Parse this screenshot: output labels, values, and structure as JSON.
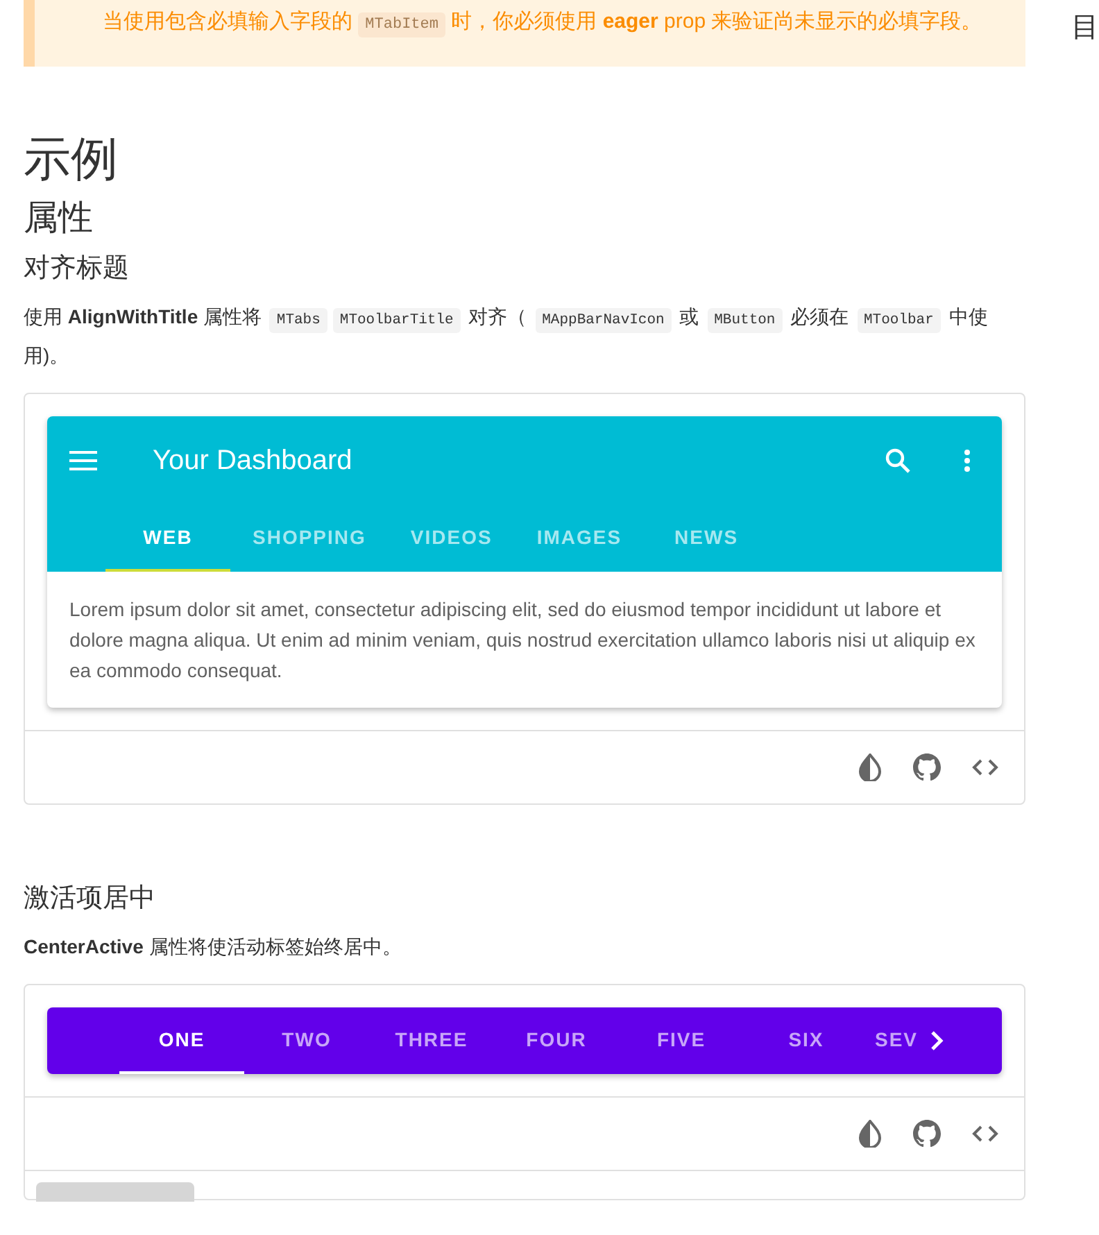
{
  "alert": {
    "text": "当使用包含必填输入字段的 ",
    "code": "MTabItem",
    "text_after": " 时，你必须使用 **eager** prop 来验证尚未显示的必填字段。"
  },
  "toc_label": "目",
  "headings": {
    "h1": "示例",
    "h2": "属性"
  },
  "sections": [
    {
      "title": "对齐标题",
      "description": [
        {
          "kind": "text",
          "text": "使用 **AlignWithTitle** 属性将 "
        },
        {
          "kind": "code",
          "text": "MTabs"
        },
        {
          "kind": "code",
          "text": "MToolbarTitle"
        },
        {
          "kind": "text",
          "text": " 对齐（ "
        },
        {
          "kind": "code",
          "text": "MAppBarNavIcon"
        },
        {
          "kind": "text",
          "text": " 或 "
        },
        {
          "kind": "code",
          "text": "MButton"
        },
        {
          "kind": "text",
          "text": " 必须在 "
        },
        {
          "kind": "code",
          "text": "MToolbar"
        },
        {
          "kind": "text",
          "text": " 中使用)。"
        }
      ],
      "demo": {
        "kind": "toolbar",
        "color": "#00bcd4",
        "title": "Your Dashboard",
        "tabs": [
          {
            "label": "WEB",
            "selected": true
          },
          {
            "label": "SHOPPING",
            "selected": false
          },
          {
            "label": "VIDEOS",
            "selected": false
          },
          {
            "label": "IMAGES",
            "selected": false
          },
          {
            "label": "NEWS",
            "selected": false
          }
        ],
        "body": "Lorem ipsum dolor sit amet, consectetur adipiscing elit, sed do eiusmod tempor incididunt ut labore et dolore magna aliqua. Ut enim ad minim veniam, quis nostrud exercitation ullamco laboris nisi ut aliquip ex ea commodo consequat."
      }
    },
    {
      "title": "激活项居中",
      "description": [
        {
          "kind": "text",
          "text": "**CenterActive** 属性将使活动标签始终居中。"
        }
      ],
      "demo": {
        "kind": "tabbar",
        "color": "#6200ea",
        "tabs": [
          {
            "label": "ONE",
            "selected": true
          },
          {
            "label": "TWO",
            "selected": false
          },
          {
            "label": "THREE",
            "selected": false
          },
          {
            "label": "FOUR",
            "selected": false
          },
          {
            "label": "FIVE",
            "selected": false
          },
          {
            "label": "SIX",
            "selected": false
          },
          {
            "label": "SEV",
            "selected": false
          }
        ]
      }
    }
  ]
}
